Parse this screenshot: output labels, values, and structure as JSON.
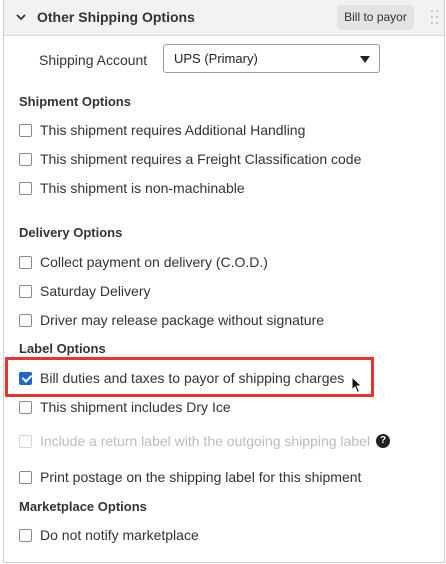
{
  "panel": {
    "title": "Other Shipping Options",
    "bill_button_label": "Bill to payor"
  },
  "shipping_account": {
    "label": "Shipping Account",
    "selected": "UPS (Primary)"
  },
  "shipment_options": {
    "title": "Shipment Options",
    "items": [
      {
        "label": "This shipment requires Additional Handling",
        "checked": false
      },
      {
        "label": "This shipment requires a Freight Classification code",
        "checked": false
      },
      {
        "label": "This shipment is non-machinable",
        "checked": false
      }
    ]
  },
  "delivery_options": {
    "title": "Delivery Options",
    "items": [
      {
        "label": "Collect payment on delivery (C.O.D.)",
        "checked": false
      },
      {
        "label": "Saturday Delivery",
        "checked": false
      },
      {
        "label": "Driver may release package without signature",
        "checked": false
      }
    ]
  },
  "label_options": {
    "title": "Label Options",
    "items": [
      {
        "label": "Bill duties and taxes to payor of shipping charges",
        "checked": true
      },
      {
        "label": "This shipment includes Dry Ice",
        "checked": false
      },
      {
        "label": "Include a return label with the outgoing shipping label",
        "checked": false,
        "disabled": true
      },
      {
        "label": "Print postage on the shipping label for this shipment",
        "checked": false
      }
    ],
    "help_glyph": "?"
  },
  "marketplace_options": {
    "title": "Marketplace Options",
    "items": [
      {
        "label": "Do not notify marketplace",
        "checked": false
      }
    ]
  },
  "colors": {
    "checkbox_checked": "#1e66c8",
    "highlight": "#e8352c",
    "header_bg": "#f2f2f2"
  },
  "icons": [
    "chevron-down-icon",
    "drag-handle-icon",
    "dropdown-caret-icon",
    "help-icon",
    "mouse-cursor-icon"
  ]
}
